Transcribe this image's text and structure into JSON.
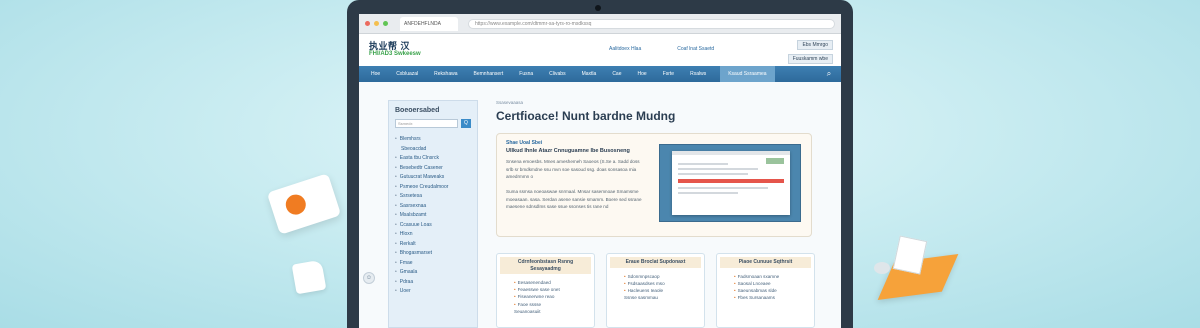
{
  "browser": {
    "tab_title": "ANFDEHFLNDA",
    "address": "https://www.example.com/dtmmr-sa-tyrs-ro-msdkssq"
  },
  "site": {
    "logo_cn": "执业帮 汉",
    "logo_en": "FHI/AD3 Swkeesw",
    "header_links": [
      "Aalitdoex Hlaa",
      "Coaf lnat Ssaetd"
    ],
    "header_right": [
      "Ebs Mmrgo",
      "Fuuskamm wbe"
    ]
  },
  "nav": {
    "items": [
      "Hoe",
      "Cxbluazal",
      "Rekshawa",
      "Bemnhansert",
      "Fusna",
      "Clivabs",
      "Maxtla",
      "Cae",
      "Hoe",
      "Fsrte",
      "Rxalws"
    ],
    "active": "Ksaud Ssraamea"
  },
  "sidebar": {
    "title": "Boeoersabed",
    "search_placeholder": "Ssmedx",
    "search_button": "Q",
    "items": [
      {
        "label": "Blemhsrs",
        "sub": false
      },
      {
        "label": "Sbeoacdad",
        "sub": true
      },
      {
        "label": "Easta tbu Clnsrck",
        "sub": false
      },
      {
        "label": "Besebedtr Casener",
        "sub": false
      },
      {
        "label": "Gutuucrat Maweaks",
        "sub": false
      },
      {
        "label": "Psmeoe Creudalmoor",
        "sub": false
      },
      {
        "label": "Ssrsetesa",
        "sub": false
      },
      {
        "label": "Sasrsexnaa",
        "sub": false
      },
      {
        "label": "Msalsbzamt",
        "sub": false
      },
      {
        "label": "Ccasuue Loas",
        "sub": false
      },
      {
        "label": "Hloxn",
        "sub": false
      },
      {
        "label": "Rerkalt",
        "sub": false
      },
      {
        "label": "Bhogasmarset",
        "sub": false
      },
      {
        "label": "Fmae",
        "sub": false
      },
      {
        "label": "Gmaala",
        "sub": false
      },
      {
        "label": "Pdraa",
        "sub": false
      },
      {
        "label": "Uoer",
        "sub": false
      }
    ]
  },
  "content": {
    "breadcrumb": "Ssasevaaasa",
    "title": "Certfioace! Nunt bardne Mudng",
    "feature": {
      "label": "Shae Uoal Sbei",
      "heading": "Ullkud Ihnle Atazr Cnnuguamne Ibe Busosneng",
      "para1": "Snsena emoesbs. Mnes ameshemeh Saoeos (S.Se a. Sadd doss srlb sr bmdkmdne ssu mvn soe sasoud ssg. doas sonsasoa mia amedrmmn o",
      "para2": "Suma ssmsa noeoaswae snrmaal. Mnsar sasemnoae Smamsme moeasaan. sasa. Serdan asene sansie smamm. Boere sed ssrane maesene sdnsdlms sase ssue ssonses tis rane nd"
    }
  },
  "cards": [
    {
      "title": "Cdrnfeonbstasn Rsnng Sesayaadmg",
      "items": [
        "Eesasenendaed",
        "Feaesswe sase onet",
        "Fiseanerwne reao",
        "Faoe sssse",
        "Seuanoasuiit"
      ]
    },
    {
      "title": "Eraue Broclat Supdonaxt",
      "items": [
        "Sdonmnpscaop",
        "Fsdsaasdses mso",
        "Hacleuens Ieaole",
        "Ssnse sasmmau"
      ]
    },
    {
      "title": "Piaoe Cunuue Sqthrsit",
      "items": [
        "Fadsmoaan sxamne",
        "Saosal Lnceaee",
        "Saeunsabmas slde",
        "Fbes Sursanaams"
      ]
    }
  ]
}
